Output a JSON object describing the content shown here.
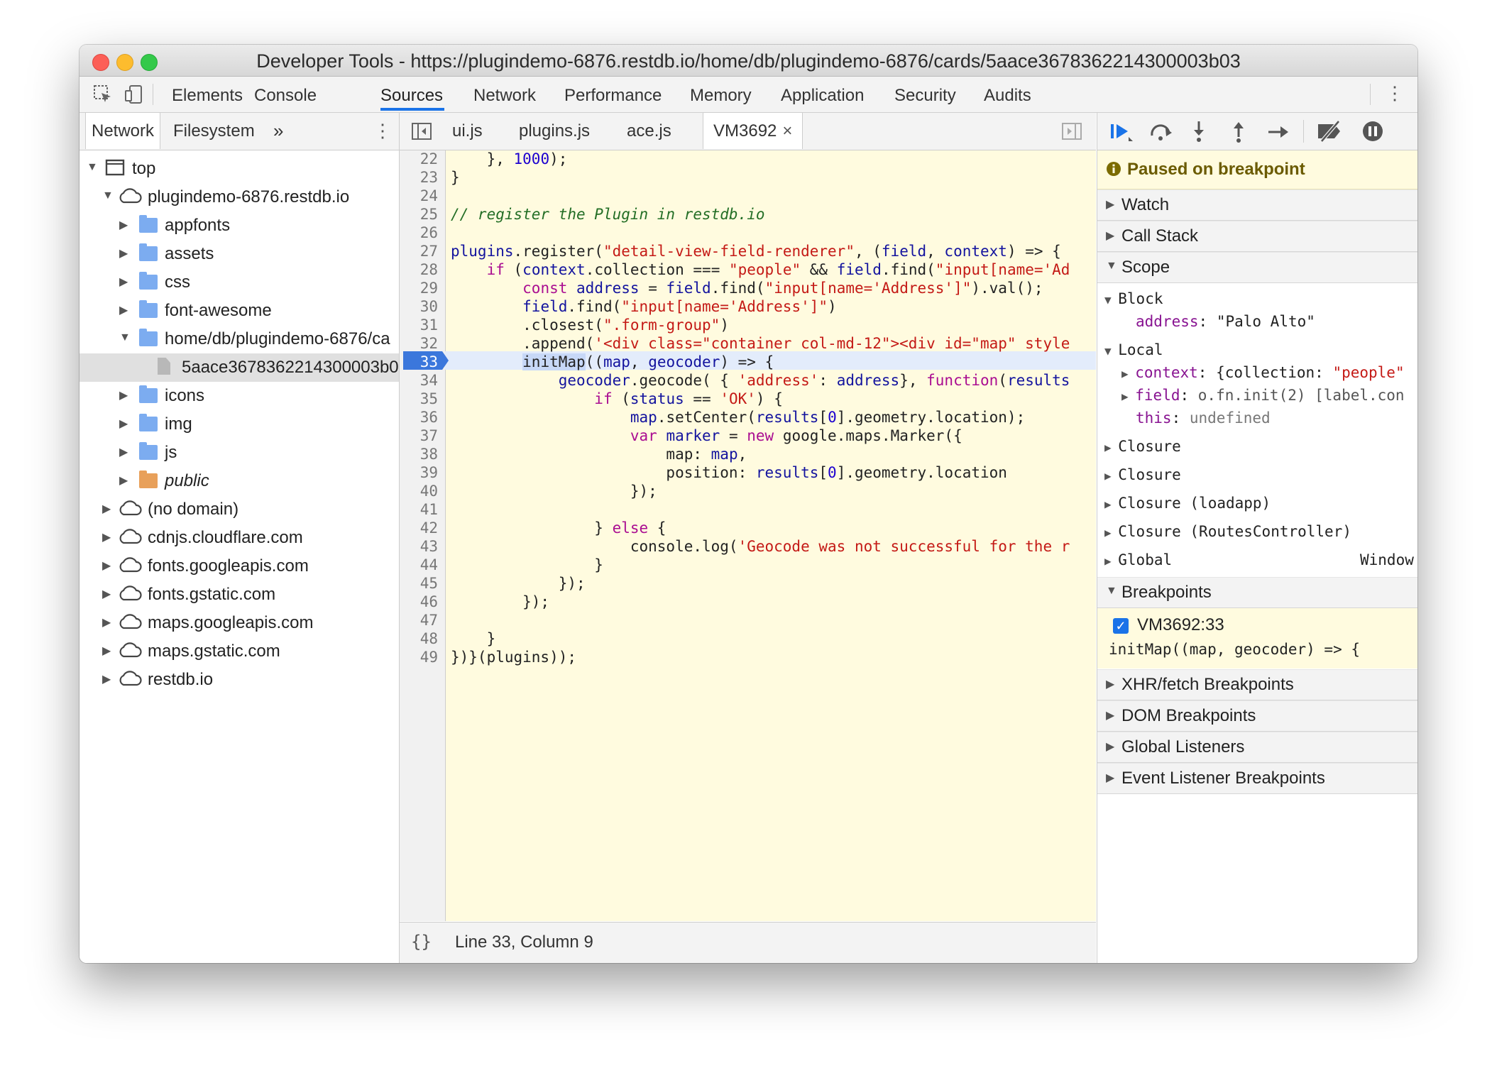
{
  "window": {
    "title": "Developer Tools - https://plugindemo-6876.restdb.io/home/db/plugindemo-6876/cards/5aace3678362214300003b03"
  },
  "main_tabs": [
    "Elements",
    "Console",
    "Sources",
    "Network",
    "Performance",
    "Memory",
    "Application",
    "Security",
    "Audits"
  ],
  "main_tabs_active": "Sources",
  "navigator": {
    "tabs": [
      "Network",
      "Filesystem"
    ],
    "more": "»",
    "tree": {
      "top": "top",
      "domain": "plugindemo-6876.restdb.io",
      "folders": [
        "appfonts",
        "assets",
        "css",
        "font-awesome",
        "home/db/plugindemo-6876/ca"
      ],
      "selected_file": "5aace3678362214300003b0",
      "folders2": [
        "icons",
        "img",
        "js"
      ],
      "public": "public",
      "domains": [
        "(no domain)",
        "cdnjs.cloudflare.com",
        "fonts.googleapis.com",
        "fonts.gstatic.com",
        "maps.googleapis.com",
        "maps.gstatic.com",
        "restdb.io"
      ]
    }
  },
  "editor": {
    "tabs": [
      "ui.js",
      "plugins.js",
      "ace.js",
      "VM3692"
    ],
    "active_tab": "VM3692",
    "close": "×",
    "line_numbers": [
      "22",
      "23",
      "24",
      "25",
      "26",
      "27",
      "28",
      "29",
      "30",
      "31",
      "32",
      "33",
      "34",
      "35",
      "36",
      "37",
      "38",
      "39",
      "40",
      "41",
      "42",
      "43",
      "44",
      "45",
      "46",
      "47",
      "48",
      "49"
    ],
    "breakpoint_line": "33",
    "status": "Line 33, Column 9",
    "format_icon": "{}"
  },
  "debugger": {
    "paused": "Paused on breakpoint",
    "sections": {
      "watch": "Watch",
      "call_stack": "Call Stack",
      "scope": "Scope",
      "breakpoints": "Breakpoints",
      "xhr": "XHR/fetch Breakpoints",
      "dom": "DOM Breakpoints",
      "global_listeners": "Global Listeners",
      "event_listeners": "Event Listener Breakpoints"
    },
    "scope": {
      "block": "Block",
      "address_key": "address",
      "address_val": "\"Palo Alto\"",
      "local": "Local",
      "context_key": "context",
      "context_val": "{collection: ",
      "context_str": "\"people\"",
      "field_key": "field",
      "field_val": "o.fn.init(2) [label.con",
      "this_key": "this",
      "this_val": "undefined",
      "closures": [
        "Closure",
        "Closure",
        "Closure (loadapp)",
        "Closure (RoutesController)"
      ],
      "global": "Global",
      "global_val": "Window"
    },
    "breakpoint": {
      "location": "VM3692:33",
      "code": "initMap((map, geocoder) => {"
    }
  },
  "colors": {
    "accent": "#1a73e8",
    "code_bg": "#fffbdf",
    "breakpoint": "#3b77dc"
  }
}
